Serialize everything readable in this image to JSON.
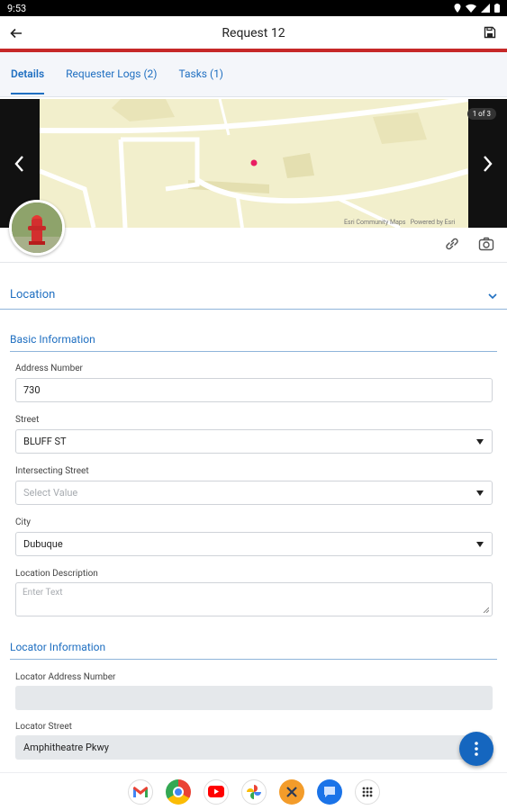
{
  "status": {
    "time": "9:53"
  },
  "header": {
    "title": "Request 12"
  },
  "tabs": [
    {
      "label": "Details",
      "active": true
    },
    {
      "label": "Requester Logs (2)",
      "active": false
    },
    {
      "label": "Tasks (1)",
      "active": false
    }
  ],
  "map": {
    "pager": "1 of 3",
    "credit_left": "Esri Community Maps",
    "credit_right": "Powered by Esri"
  },
  "section": {
    "title": "Location"
  },
  "basic_info": {
    "title": "Basic Information",
    "address_number": {
      "label": "Address Number",
      "value": "730"
    },
    "street": {
      "label": "Street",
      "value": "BLUFF ST"
    },
    "intersecting_street": {
      "label": "Intersecting Street",
      "placeholder": "Select Value"
    },
    "city": {
      "label": "City",
      "value": "Dubuque"
    },
    "location_description": {
      "label": "Location Description",
      "placeholder": "Enter Text"
    }
  },
  "locator_info": {
    "title": "Locator Information",
    "locator_address_number": {
      "label": "Locator Address Number",
      "value": ""
    },
    "locator_street": {
      "label": "Locator Street",
      "value": "Amphitheatre Pkwy"
    }
  },
  "dock_apps": [
    "gmail-icon",
    "chrome-icon",
    "youtube-icon",
    "photos-icon",
    "tools-app-icon",
    "messages-icon",
    "app-drawer-icon"
  ],
  "colors": {
    "accent": "#1f6fc1",
    "brand_red": "#c62828",
    "fab": "#1566bf",
    "map_bg": "#f2efcc"
  }
}
